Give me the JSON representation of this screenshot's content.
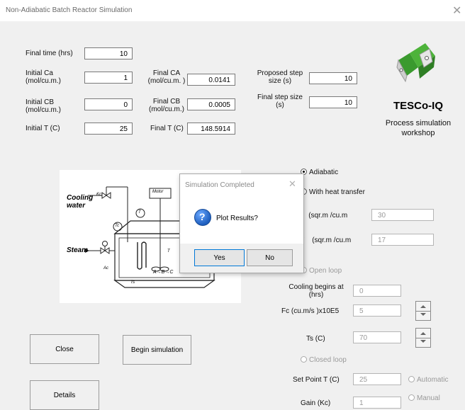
{
  "window": {
    "title": "Non-Adiabatic Batch Reactor Simulation",
    "close_glyph": "✕"
  },
  "fields": {
    "final_time": {
      "label": "Final time (hrs)",
      "value": "10"
    },
    "initial_ca": {
      "label1": "Initial Ca",
      "label2": "(mol/cu.m.)",
      "value": "1"
    },
    "initial_cb": {
      "label1": "Initial CB",
      "label2": "(mol/cu.m.)",
      "value": "0"
    },
    "initial_t": {
      "label": "Initial T (C)",
      "value": "25"
    },
    "final_ca": {
      "label1": "Final CA",
      "label2": "(mol/cu.m. )",
      "value": "0.0141"
    },
    "final_cb": {
      "label1": "Final CB",
      "label2": "(mol/cu.m.)",
      "value": "0.0005"
    },
    "final_t": {
      "label": "Final T (C)",
      "value": "148.5914"
    },
    "proposed_step": {
      "label1": "Proposed step",
      "label2": "size (s)",
      "value": "10"
    },
    "final_step": {
      "label1": "Final step size",
      "label2": "(s)",
      "value": "10"
    }
  },
  "brand": {
    "name": "TESCo-IQ",
    "tag1": "Process simulation",
    "tag2": "workshop"
  },
  "diagram": {
    "cooling1": "Cooling",
    "cooling2": "water",
    "steam": "Steam",
    "motor": "Motor",
    "reaction": "A→B→C",
    "T": "T",
    "Tc": "Tc",
    "Ts": "Ts",
    "Kc": "Kc",
    "Ac": "Ac"
  },
  "options": {
    "adiabatic": "Adiabatic",
    "heat_transfer": "With heat transfer",
    "av_label": "A/V    (sqr.m /cu.m",
    "av_value": "30",
    "ac_label": "Ac/V    (sqr.m /cu.m",
    "ac_value": "17",
    "open_loop": "Open loop",
    "cooling_begins1": "Cooling begins at",
    "cooling_begins2": "(hrs)",
    "cooling_begins_value": "0",
    "fc_label": "Fc  (cu.m/s )x10E5",
    "fc_value": "5",
    "ts_label": "Ts (C)",
    "ts_value": "70",
    "closed_loop": "Closed loop",
    "setpoint_label": "Set Point T (C)",
    "setpoint_value": "25",
    "automatic": "Automatic",
    "gain_label": "Gain (Kc)",
    "gain_value": "1",
    "manual": "Manual"
  },
  "buttons": {
    "close": "Close",
    "begin": "Begin simulation",
    "details": "Details"
  },
  "dialog": {
    "title": "Simulation Completed",
    "close_glyph": "✕",
    "message": "Plot Results?",
    "yes": "Yes",
    "no": "No",
    "icon": "question-icon"
  },
  "colors": {
    "logo_green": "#3a9a2e",
    "question_blue": "#1f5fbf"
  }
}
